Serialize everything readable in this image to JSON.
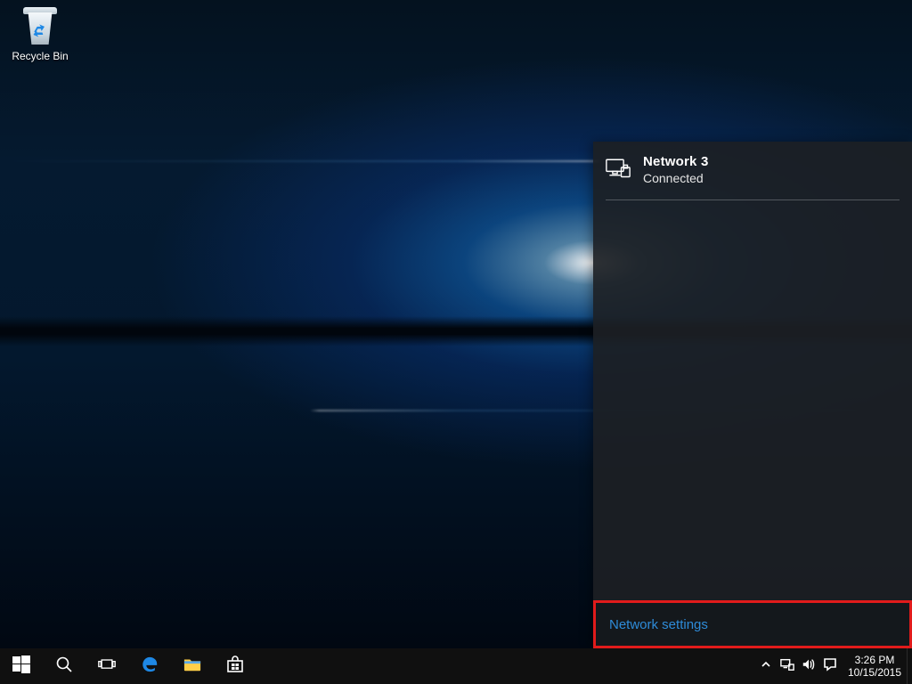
{
  "desktop": {
    "icons": {
      "recycle_bin": {
        "label": "Recycle Bin"
      }
    }
  },
  "network_flyout": {
    "connection": {
      "name": "Network  3",
      "status": "Connected",
      "icon": "ethernet-icon"
    },
    "settings_link": "Network settings",
    "settings_highlighted": true
  },
  "taskbar": {
    "start": {
      "name": "start-button"
    },
    "search": {
      "name": "search-button"
    },
    "taskview": {
      "name": "task-view-button"
    },
    "pinned": [
      {
        "name": "edge-app"
      },
      {
        "name": "file-explorer-app"
      },
      {
        "name": "store-app"
      }
    ],
    "tray": {
      "chevron": "show-hidden-icons",
      "network": "network-tray-icon",
      "volume": "volume-tray-icon",
      "action_center": "action-center-tray-icon"
    },
    "clock": {
      "time": "3:26 PM",
      "date": "10/15/2015"
    }
  }
}
